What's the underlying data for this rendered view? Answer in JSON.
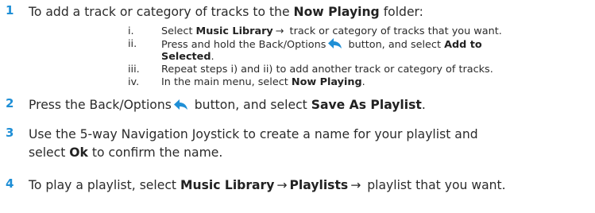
{
  "colors": {
    "step_number": "#1f8fd6",
    "icon": "#1f8fd6",
    "text": "#2b2b2b"
  },
  "icons": {
    "back_options": "back-arrow-icon"
  },
  "steps": [
    {
      "number": "1",
      "pre": "To add a track or category of tracks to the ",
      "bold": "Now Playing",
      "post": " folder:"
    },
    {
      "number": "2",
      "pre": "Press the Back/Options",
      "mid": " button, and select ",
      "bold": "Save As Playlist",
      "post": "."
    },
    {
      "number": "3",
      "line1": "Use the 5-way Navigation Joystick to create a name for your playlist and",
      "line2_pre": "select ",
      "line2_bold": "Ok",
      "line2_post": " to confirm the name."
    },
    {
      "number": "4",
      "pre": "To play a playlist, select ",
      "bold1": "Music Library",
      "arrow": "→",
      "bold2": "Playlists",
      "post": " playlist that you want."
    }
  ],
  "substeps": [
    {
      "roman": "i.",
      "pre": "Select ",
      "bold": "Music Library",
      "arrow": "→",
      "post": " track or category of tracks that you want."
    },
    {
      "roman": "ii.",
      "pre": "Press and hold the Back/Options",
      "mid": " button, and select ",
      "bold1": "Add to",
      "bold2": "Selected",
      "post": "."
    },
    {
      "roman": "iii.",
      "text": "Repeat steps i) and ii) to add another track or category of tracks."
    },
    {
      "roman": "iv.",
      "pre": "In the main menu, select ",
      "bold": "Now Playing",
      "post": "."
    }
  ]
}
